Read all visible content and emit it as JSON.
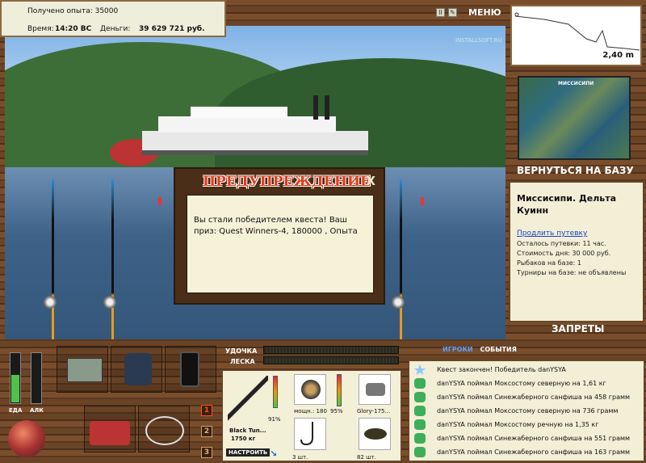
{
  "info": {
    "exp_label": "Получено опыта: 35000",
    "time_label": "Время:",
    "time_value": "14:20 ВС",
    "money_label": "Деньги:",
    "money_value": "39 629 721 руб."
  },
  "menu": {
    "pause": "II",
    "settings": "✎",
    "label": "МЕНЮ"
  },
  "watermark": "INSTALLSOFT.RU",
  "depth": {
    "value": "2,40 m"
  },
  "map": {
    "title": "МИССИСИПИ"
  },
  "location": {
    "back": "ВЕРНУТЬСЯ НА БАЗУ",
    "name": "Миссисипи. Дельта Куинн",
    "extend": "Продлить путевку",
    "lines": [
      "Осталось путевки: 11 час.",
      "Стоимость дня: 30 000 руб.",
      "Рыбаков на базе: 1",
      "Турниры на базе: не объявлены"
    ],
    "bans": "ЗАПРЕТЫ"
  },
  "warning": {
    "title": "ПРЕДУПРЕЖДЕНИЕ",
    "close": "X",
    "message": "Вы стали победителем квеста! Ваш приз: Quest Winners-4, 180000 , Опыта"
  },
  "meters": {
    "food_label": "ЕДА",
    "alc_label": "АЛК",
    "food_level": 0.55,
    "alc_level": 0.0
  },
  "tabs_numbers": [
    "1",
    "2",
    "3"
  ],
  "tackle": {
    "rod_label": "УДОЧКА",
    "line_label": "ЛЕСКА",
    "rod_name": "Black Tun...",
    "rod_weight": "1750 кг",
    "rod_pct": "91%",
    "reel_name": "мощн.: 180",
    "reel_pct": "95%",
    "lure_name": "Glory-175...",
    "hook_count": "3 шт.",
    "bait_count": "82 шт.",
    "setup": "НАСТРОИТЬ"
  },
  "events": {
    "tab_players": "ИГРОКИ",
    "tab_events": "СОБЫТИЯ",
    "items": [
      "Квест закончен! Победитель danYSYA",
      "danYSYA поймал Моксостому северную на 1,61 кг",
      "danYSYA поймал Синежаберного санфиша на 458 грамм",
      "danYSYA поймал Моксостому северную на 736 грамм",
      "danYSYA поймал Моксостому речную на 1,35 кг",
      "danYSYA поймал Синежаберного санфиша на 551 грамм",
      "danYSYA поймал Синежаберного санфиша на 163 грамм"
    ]
  },
  "colors": {
    "accent": "#e23b1c",
    "wood": "#6b4426",
    "panel": "#f2efd6",
    "meter": "#4fc24a"
  }
}
